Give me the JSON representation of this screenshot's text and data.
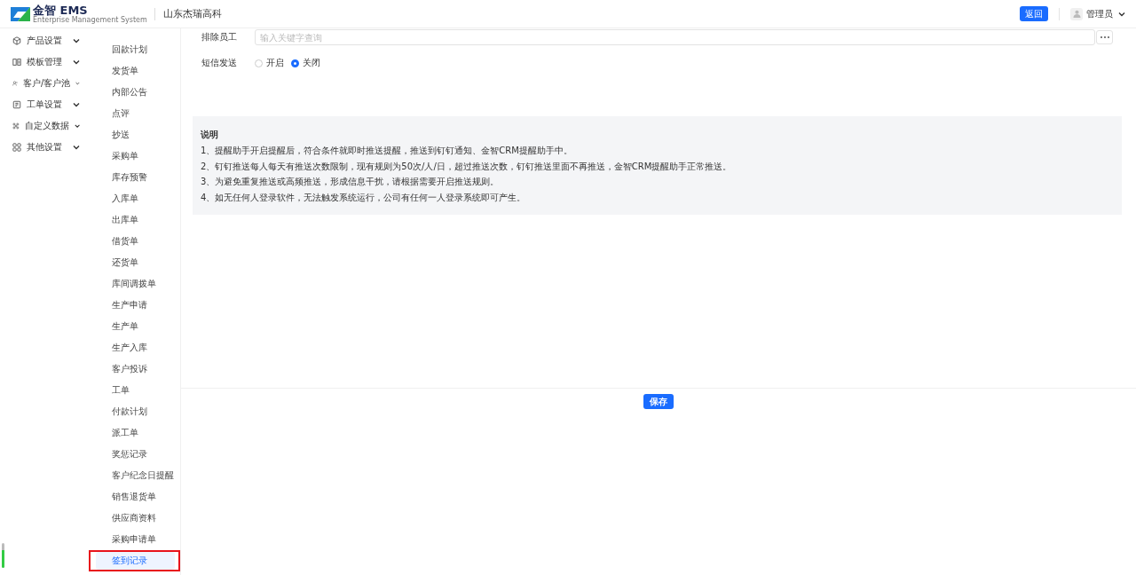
{
  "header": {
    "logo_text": "金智 EMS",
    "logo_subtitle": "Enterprise Management System",
    "company": "山东杰瑞高科",
    "back_button": "返回",
    "user": "管理员"
  },
  "sidebar": {
    "items": [
      {
        "label": "产品设置"
      },
      {
        "label": "模板管理"
      },
      {
        "label": "客户/客户池"
      },
      {
        "label": "工单设置"
      },
      {
        "label": "自定义数据"
      },
      {
        "label": "其他设置"
      }
    ]
  },
  "submenu": {
    "items": [
      {
        "label": "回款计划",
        "selected": false,
        "outlined": false
      },
      {
        "label": "发货单",
        "selected": false,
        "outlined": false
      },
      {
        "label": "内部公告",
        "selected": false,
        "outlined": false
      },
      {
        "label": "点评",
        "selected": false,
        "outlined": false
      },
      {
        "label": "抄送",
        "selected": false,
        "outlined": false
      },
      {
        "label": "采购单",
        "selected": false,
        "outlined": false
      },
      {
        "label": "库存预警",
        "selected": false,
        "outlined": false
      },
      {
        "label": "入库单",
        "selected": false,
        "outlined": false
      },
      {
        "label": "出库单",
        "selected": false,
        "outlined": false
      },
      {
        "label": "借货单",
        "selected": false,
        "outlined": false
      },
      {
        "label": "还货单",
        "selected": false,
        "outlined": false
      },
      {
        "label": "库间调拨单",
        "selected": false,
        "outlined": false
      },
      {
        "label": "生产申请",
        "selected": false,
        "outlined": false
      },
      {
        "label": "生产单",
        "selected": false,
        "outlined": false
      },
      {
        "label": "生产入库",
        "selected": false,
        "outlined": false
      },
      {
        "label": "客户投诉",
        "selected": false,
        "outlined": false
      },
      {
        "label": "工单",
        "selected": false,
        "outlined": false
      },
      {
        "label": "付款计划",
        "selected": false,
        "outlined": false
      },
      {
        "label": "派工单",
        "selected": false,
        "outlined": false
      },
      {
        "label": "奖惩记录",
        "selected": false,
        "outlined": false
      },
      {
        "label": "客户纪念日提醒",
        "selected": false,
        "outlined": false
      },
      {
        "label": "销售退货单",
        "selected": false,
        "outlined": false
      },
      {
        "label": "供应商资料",
        "selected": false,
        "outlined": false
      },
      {
        "label": "采购申请单",
        "selected": false,
        "outlined": false
      },
      {
        "label": "签到记录",
        "selected": true,
        "outlined": true
      }
    ]
  },
  "form": {
    "fields": [
      {
        "kind": "picker",
        "label": "排除员工",
        "placeholder": "输入关键字查询"
      },
      {
        "kind": "radio",
        "label": "短信发送",
        "options": [
          {
            "label": "开启",
            "selected": false
          },
          {
            "label": "关闭",
            "selected": true
          }
        ]
      }
    ]
  },
  "note": {
    "title": "说明",
    "lines": [
      "1、提醒助手开启提醒后，符合条件就即时推送提醒，推送到钉钉通知、金智CRM提醒助手中。",
      "2、钉钉推送每人每天有推送次数限制，现有规则为50次/人/日，超过推送次数，钉钉推送里面不再推送，金智CRM提醒助手正常推送。",
      "3、为避免重复推送或高频推送，形成信息干扰，请根据需要开启推送规则。",
      "4、如无任何人登录软件，无法触发系统运行，公司有任何一人登录系统即可产生。"
    ]
  },
  "save_button": "保存"
}
